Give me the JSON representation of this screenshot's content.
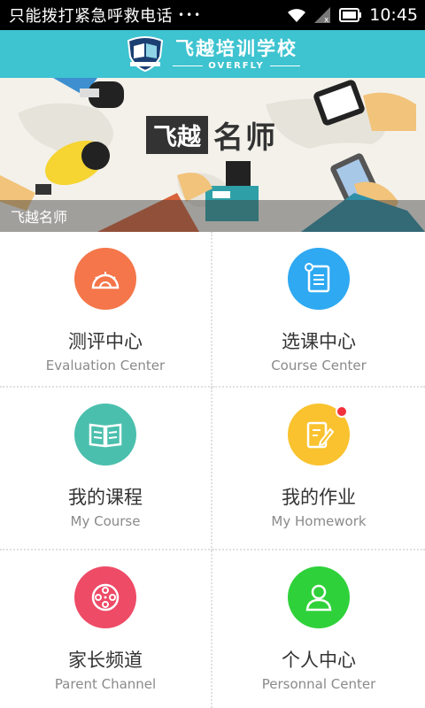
{
  "status_bar": {
    "left_text": "只能拨打紧急呼救电话",
    "dots": "•••",
    "time": "10:45"
  },
  "header": {
    "title": "飞越培训学校",
    "subtitle": "OVERFLY"
  },
  "banner": {
    "title_box": "飞越",
    "title_rest": "名师",
    "caption": "飞越名师"
  },
  "menu": [
    {
      "zh": "测评中心",
      "en": "Evaluation Center",
      "color": "#f4764a",
      "icon": "protractor-icon"
    },
    {
      "zh": "选课中心",
      "en": "Course Center",
      "color": "#2ea9f2",
      "icon": "document-icon"
    },
    {
      "zh": "我的课程",
      "en": "My Course",
      "color": "#4bbfad",
      "icon": "book-icon"
    },
    {
      "zh": "我的作业",
      "en": "My Homework",
      "color": "#f9c22e",
      "icon": "homework-icon"
    },
    {
      "zh": "家长频道",
      "en": "Parent Channel",
      "color": "#ee4b67",
      "icon": "film-reel-icon"
    },
    {
      "zh": "个人中心",
      "en": "Personnal Center",
      "color": "#2fd13a",
      "icon": "person-icon"
    }
  ]
}
